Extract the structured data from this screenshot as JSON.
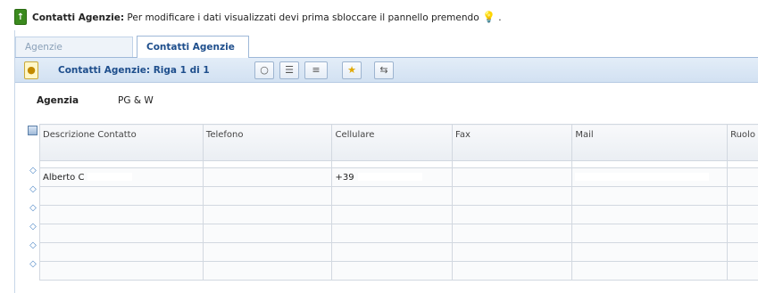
{
  "infobar": {
    "title": "Contatti Agenzie:",
    "message": "Per modificare i dati visualizzati devi prima sbloccare il pannello premendo",
    "lock_icon": "lock-icon",
    "bulb_icon": "bulb-icon",
    "trailing": "."
  },
  "tabs": [
    {
      "label": "Agenzie",
      "active": false
    },
    {
      "label": "Contatti Agenzie",
      "active": true
    }
  ],
  "toolbar": {
    "title": "Contatti Agenzie: Riga 1 di 1",
    "buttons": [
      "bulb-icon",
      "locate-icon",
      "list-icon",
      "view-icon",
      "star-icon",
      "shuffle-icon"
    ]
  },
  "agency": {
    "label": "Agenzia",
    "value": "PG & W"
  },
  "grid": {
    "columns": [
      "Descrizione Contatto",
      "Telefono",
      "Cellulare",
      "Fax",
      "Mail",
      "Ruolo"
    ],
    "rows": [
      [
        "Alberto C",
        "",
        "+39",
        "",
        "",
        ""
      ],
      [
        "",
        "",
        "",
        "",
        "",
        ""
      ],
      [
        "",
        "",
        "",
        "",
        "",
        ""
      ],
      [
        "",
        "",
        "",
        "",
        "",
        ""
      ],
      [
        "",
        "",
        "",
        "",
        "",
        ""
      ],
      [
        "",
        "",
        "",
        "",
        "",
        ""
      ]
    ]
  },
  "colors": {
    "accent": "#1e4e8c",
    "toolbar_bg": "#d9e6f5",
    "lock_green": "#3b8a1e",
    "bulb_yellow": "#e1b100"
  }
}
